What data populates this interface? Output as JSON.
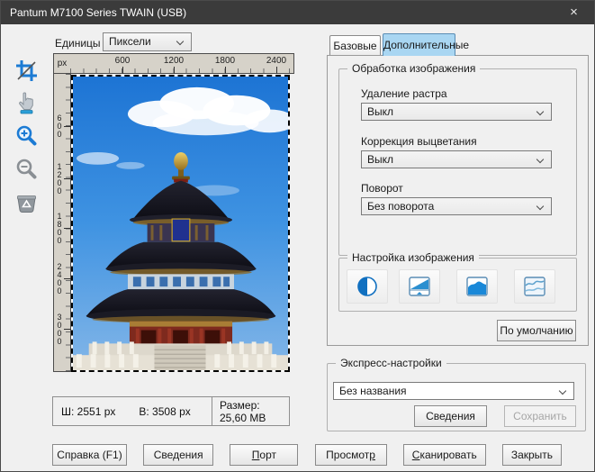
{
  "title_bar": {
    "title": "Pantum M7100 Series TWAIN (USB)",
    "close_glyph": "×"
  },
  "toolbar": {
    "units_label": "Единицы",
    "units_value": "Пиксели"
  },
  "tools": [
    "crop",
    "pan",
    "zoom-in",
    "zoom-out",
    "delete-preview"
  ],
  "ruler": {
    "unit": "px",
    "h_ticks": [
      "600",
      "1200",
      "1800",
      "2400"
    ],
    "v_ticks": [
      "600",
      "1200",
      "1800",
      "2400",
      "3000"
    ]
  },
  "preview": {
    "image_subject": "temple-of-heaven-photo"
  },
  "status": {
    "width_label": "Ш: 2551 px",
    "height_label": "В: 3508 px",
    "size_label": "Размер: 25,60 MB"
  },
  "tabs": {
    "basic": "Базовые",
    "advanced": "Дополнительные"
  },
  "processing": {
    "title": "Обработка изображения",
    "fields": [
      {
        "label": "Удаление растра",
        "value": "Выкл"
      },
      {
        "label": "Коррекция выцветания",
        "value": "Выкл"
      },
      {
        "label": "Поворот",
        "value": "Без поворота"
      }
    ]
  },
  "adjustment": {
    "title": "Настройка изображения",
    "icons": [
      "contrast-icon",
      "brightness-icon",
      "saturation-icon",
      "curves-icon"
    ],
    "default_button": "По умолчанию"
  },
  "express": {
    "title": "Экспресс-настройки",
    "preset_value": "Без названия",
    "details_button": "Сведения",
    "save_button": "Сохранить"
  },
  "footer": {
    "buttons": [
      {
        "pre": "Справка (F1)",
        "u": "",
        "post": ""
      },
      {
        "pre": "Сведения",
        "u": "",
        "post": ""
      },
      {
        "pre": "",
        "u": "П",
        "post": "орт"
      },
      {
        "pre": "Просмот",
        "u": "р",
        "post": ""
      },
      {
        "pre": "",
        "u": "С",
        "post": "канировать"
      },
      {
        "pre": "Закрыть",
        "u": "",
        "post": ""
      }
    ]
  },
  "colors": {
    "title_bar": "#3b3b3b",
    "accent_blue": "#1c7bd4",
    "active_tab": "#a9d6f2",
    "sky_top": "#1d74d4",
    "roof_dark": "#15151d",
    "wall_red": "#7e2a1e"
  }
}
